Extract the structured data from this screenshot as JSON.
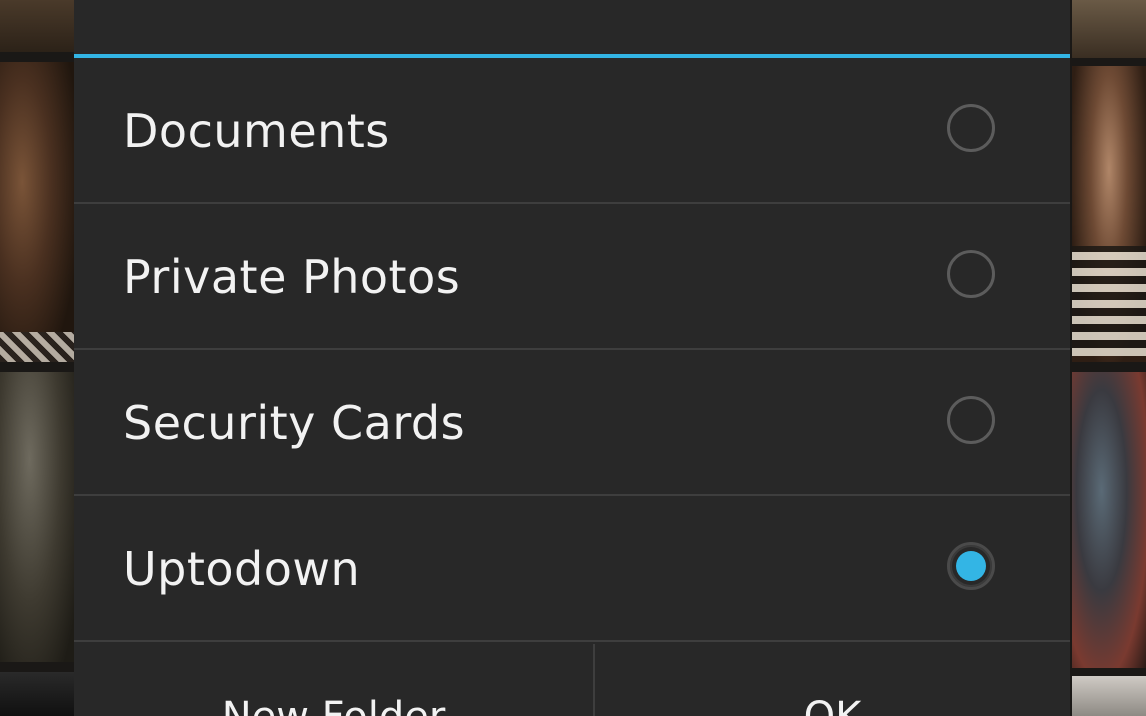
{
  "dialog": {
    "accent_color": "#33b5e5",
    "items": [
      {
        "label": "Documents",
        "checked": false
      },
      {
        "label": "Private Photos",
        "checked": false
      },
      {
        "label": "Security Cards",
        "checked": false
      },
      {
        "label": "Uptodown",
        "checked": true
      }
    ],
    "buttons": {
      "new_folder": "New Folder",
      "ok": "OK"
    }
  }
}
